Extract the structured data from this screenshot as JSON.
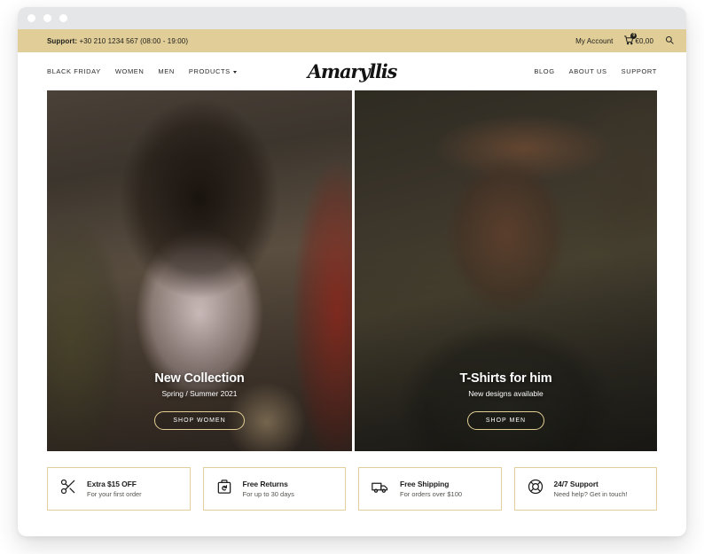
{
  "browser": {
    "dots": [
      "dot-red",
      "dot-yellow",
      "dot-green"
    ]
  },
  "topbar": {
    "support_label": "Support:",
    "support_value": " +30 210 1234 567 (08:00 - 19:00)",
    "my_account": "My Account",
    "cart_badge": "0",
    "cart_total": "€0,00",
    "search_icon": "search-icon",
    "cart_icon": "shopping-cart-icon",
    "bg_color": "#e1cd97"
  },
  "nav": {
    "logo": "Amaryllis",
    "left_items": [
      {
        "label": "BLACK FRIDAY",
        "has_caret": false
      },
      {
        "label": "WOMEN",
        "has_caret": false
      },
      {
        "label": "MEN",
        "has_caret": false
      },
      {
        "label": "PRODUCTS",
        "has_caret": true
      }
    ],
    "right_items": [
      {
        "label": "BLOG"
      },
      {
        "label": "ABOUT US"
      },
      {
        "label": "SUPPORT"
      }
    ]
  },
  "hero": {
    "panels": [
      {
        "id": "women",
        "title": "New Collection",
        "subtitle": "Spring / Summer 2021",
        "button": "SHOP WOMEN"
      },
      {
        "id": "men",
        "title": "T-Shirts for him",
        "subtitle": "New designs available",
        "button": "SHOP MEN"
      }
    ]
  },
  "features": [
    {
      "icon": "scissors-icon",
      "title": "Extra $15 OFF",
      "desc": "For your first order"
    },
    {
      "icon": "return-box-icon",
      "title": "Free Returns",
      "desc": "For up to 30 days"
    },
    {
      "icon": "delivery-truck-icon",
      "title": "Free Shipping",
      "desc": "For orders over $100"
    },
    {
      "icon": "lifebuoy-icon",
      "title": "24/7 Support",
      "desc": "Need help? Get in touch!"
    }
  ],
  "colors": {
    "accent_gold": "#e1cd97",
    "border_gold": "#e2cf9b",
    "text_dark": "#1d1d1d",
    "chrome_gray": "#e5e6e8"
  }
}
